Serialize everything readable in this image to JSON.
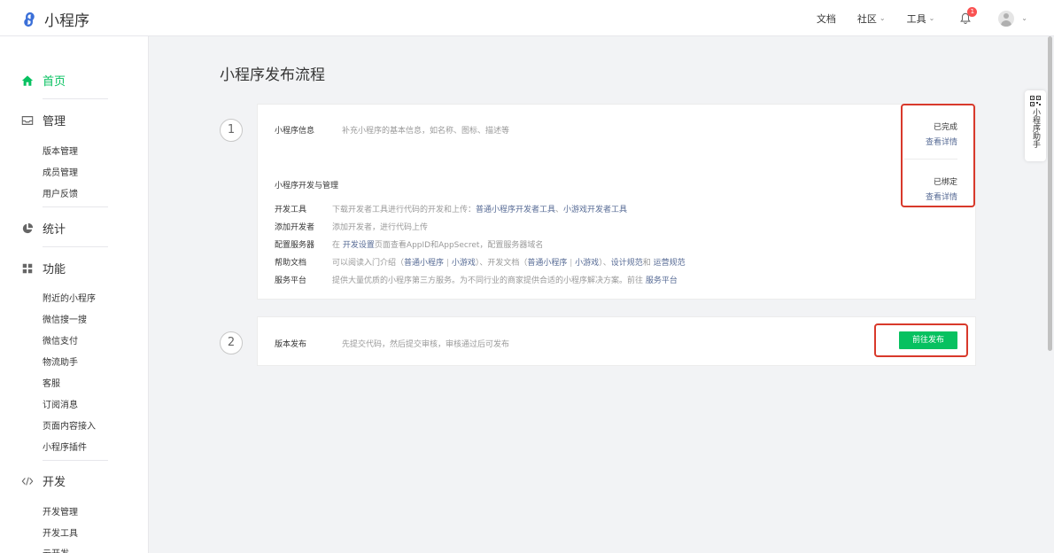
{
  "header": {
    "logo_text": "小程序",
    "nav": [
      {
        "label": "文档",
        "has_dropdown": false
      },
      {
        "label": "社区",
        "has_dropdown": true
      },
      {
        "label": "工具",
        "has_dropdown": true
      }
    ],
    "notification_count": "1"
  },
  "sidebar": {
    "home": "首页",
    "manage": {
      "title": "管理",
      "items": [
        "版本管理",
        "成员管理",
        "用户反馈"
      ]
    },
    "stats": "统计",
    "features": {
      "title": "功能",
      "items": [
        "附近的小程序",
        "微信搜一搜",
        "微信支付",
        "物流助手",
        "客服",
        "订阅消息",
        "页面内容接入",
        "小程序插件"
      ]
    },
    "dev": {
      "title": "开发",
      "items": [
        "开发管理",
        "开发工具",
        "云开发"
      ]
    }
  },
  "main": {
    "title": "小程序发布流程",
    "step1": {
      "number": "1",
      "info": {
        "label": "小程序信息",
        "desc": "补充小程序的基本信息，如名称、图标、描述等",
        "status": "已完成",
        "link": "查看详情"
      },
      "dev": {
        "label": "小程序开发与管理",
        "status": "已绑定",
        "link": "查看详情",
        "rows": {
          "tools": {
            "label": "开发工具",
            "text": "下载开发者工具进行代码的开发和上传：",
            "link1": "普通小程序开发者工具",
            "sep": "、",
            "link2": "小游戏开发者工具"
          },
          "add_dev": {
            "label": "添加开发者",
            "text": "添加开发者，进行代码上传"
          },
          "server": {
            "label": "配置服务器",
            "pre": "在",
            "link": "开发设置",
            "post": "页面查看AppID和AppSecret，配置服务器域名"
          },
          "help": {
            "label": "帮助文档",
            "t1": "可以阅读入门介绍（",
            "l1": "普通小程序",
            "s1": "|",
            "l2": "小游戏",
            "t2": "）、开发文档（",
            "l3": "普通小程序",
            "s2": "|",
            "l4": "小游戏",
            "t3": "）、",
            "l5": "设计规范",
            "t4": "和",
            "l6": "运营规范"
          },
          "service": {
            "label": "服务平台",
            "text": "提供大量优质的小程序第三方服务。为不同行业的商家提供合适的小程序解决方案。前往",
            "link": "服务平台"
          }
        }
      }
    },
    "step2": {
      "number": "2",
      "label": "版本发布",
      "desc": "先提交代码，然后提交审核，审核通过后可发布",
      "button": "前往发布"
    }
  },
  "assistant": {
    "label": "小程序助手",
    "icon": "qr-code-icon"
  },
  "colors": {
    "brand_green": "#07c160",
    "link": "#576b95",
    "highlight_red": "#d8392b"
  }
}
